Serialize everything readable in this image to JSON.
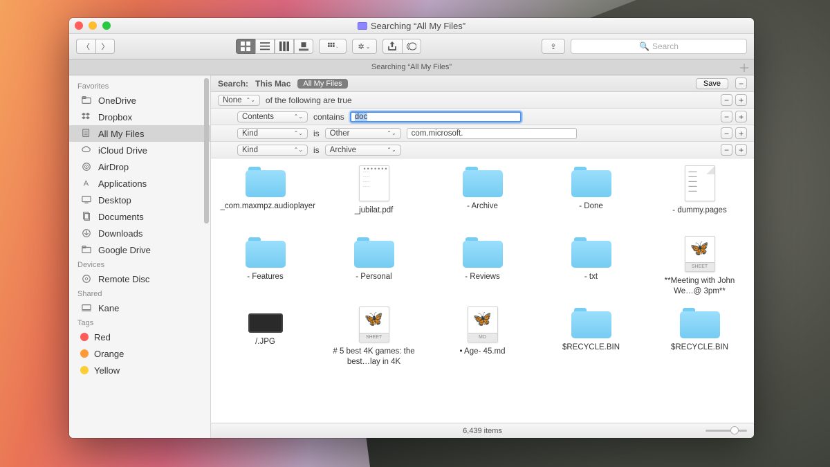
{
  "window": {
    "title": "Searching “All My Files”"
  },
  "toolbar": {
    "search_placeholder": "Search"
  },
  "tab": {
    "label": "Searching “All My Files”"
  },
  "sidebar": {
    "groups": {
      "favorites": "Favorites",
      "devices": "Devices",
      "shared": "Shared",
      "tags": "Tags"
    },
    "favorites": [
      {
        "label": "OneDrive",
        "icon": "folder"
      },
      {
        "label": "Dropbox",
        "icon": "dropbox"
      },
      {
        "label": "All My Files",
        "icon": "all-files",
        "selected": true
      },
      {
        "label": "iCloud Drive",
        "icon": "cloud"
      },
      {
        "label": "AirDrop",
        "icon": "airdrop"
      },
      {
        "label": "Applications",
        "icon": "apps"
      },
      {
        "label": "Desktop",
        "icon": "desktop"
      },
      {
        "label": "Documents",
        "icon": "documents"
      },
      {
        "label": "Downloads",
        "icon": "downloads"
      },
      {
        "label": "Google Drive",
        "icon": "folder"
      }
    ],
    "devices": [
      {
        "label": "Remote Disc",
        "icon": "disc"
      }
    ],
    "shared": [
      {
        "label": "Kane",
        "icon": "computer"
      }
    ],
    "tags": [
      {
        "label": "Red",
        "color": "#fc5b57"
      },
      {
        "label": "Orange",
        "color": "#fd9937"
      },
      {
        "label": "Yellow",
        "color": "#fdcd34"
      }
    ]
  },
  "search": {
    "label": "Search:",
    "scopes": {
      "this_mac": "This Mac",
      "all_my_files": "All My Files"
    },
    "save": "Save",
    "rows": [
      {
        "indent": 0,
        "left_selector": "None",
        "text": "of the following are true"
      },
      {
        "indent": 1,
        "left_selector": "Contents",
        "op": "contains",
        "input_type": "focused",
        "value": "doc"
      },
      {
        "indent": 1,
        "left_selector": "Kind",
        "op": "is",
        "mid_selector": "Other",
        "input_type": "plain",
        "value": "com.microsoft."
      },
      {
        "indent": 1,
        "left_selector": "Kind",
        "op": "is",
        "mid_selector": "Archive"
      }
    ]
  },
  "results": [
    {
      "type": "folder",
      "name": "_com.maxmpz.audioplayer"
    },
    {
      "type": "pdf",
      "name": "_jubilat.pdf"
    },
    {
      "type": "folder",
      "name": "- Archive"
    },
    {
      "type": "folder",
      "name": "- Done"
    },
    {
      "type": "pages",
      "name": "- dummy.pages"
    },
    {
      "type": "folder",
      "name": "- Features"
    },
    {
      "type": "folder",
      "name": "- Personal"
    },
    {
      "type": "folder",
      "name": "- Reviews"
    },
    {
      "type": "folder",
      "name": "- txt"
    },
    {
      "type": "sheet",
      "name": "**Meeting with John We…@ 3pm**"
    },
    {
      "type": "jpg",
      "name": "/.JPG"
    },
    {
      "type": "sheet",
      "name": "# 5 best 4K games: the best…lay in 4K"
    },
    {
      "type": "md",
      "name": "• Age- 45.md"
    },
    {
      "type": "folder",
      "name": "$RECYCLE.BIN"
    },
    {
      "type": "folder",
      "name": "$RECYCLE.BIN"
    }
  ],
  "status": {
    "count": "6,439 items"
  }
}
